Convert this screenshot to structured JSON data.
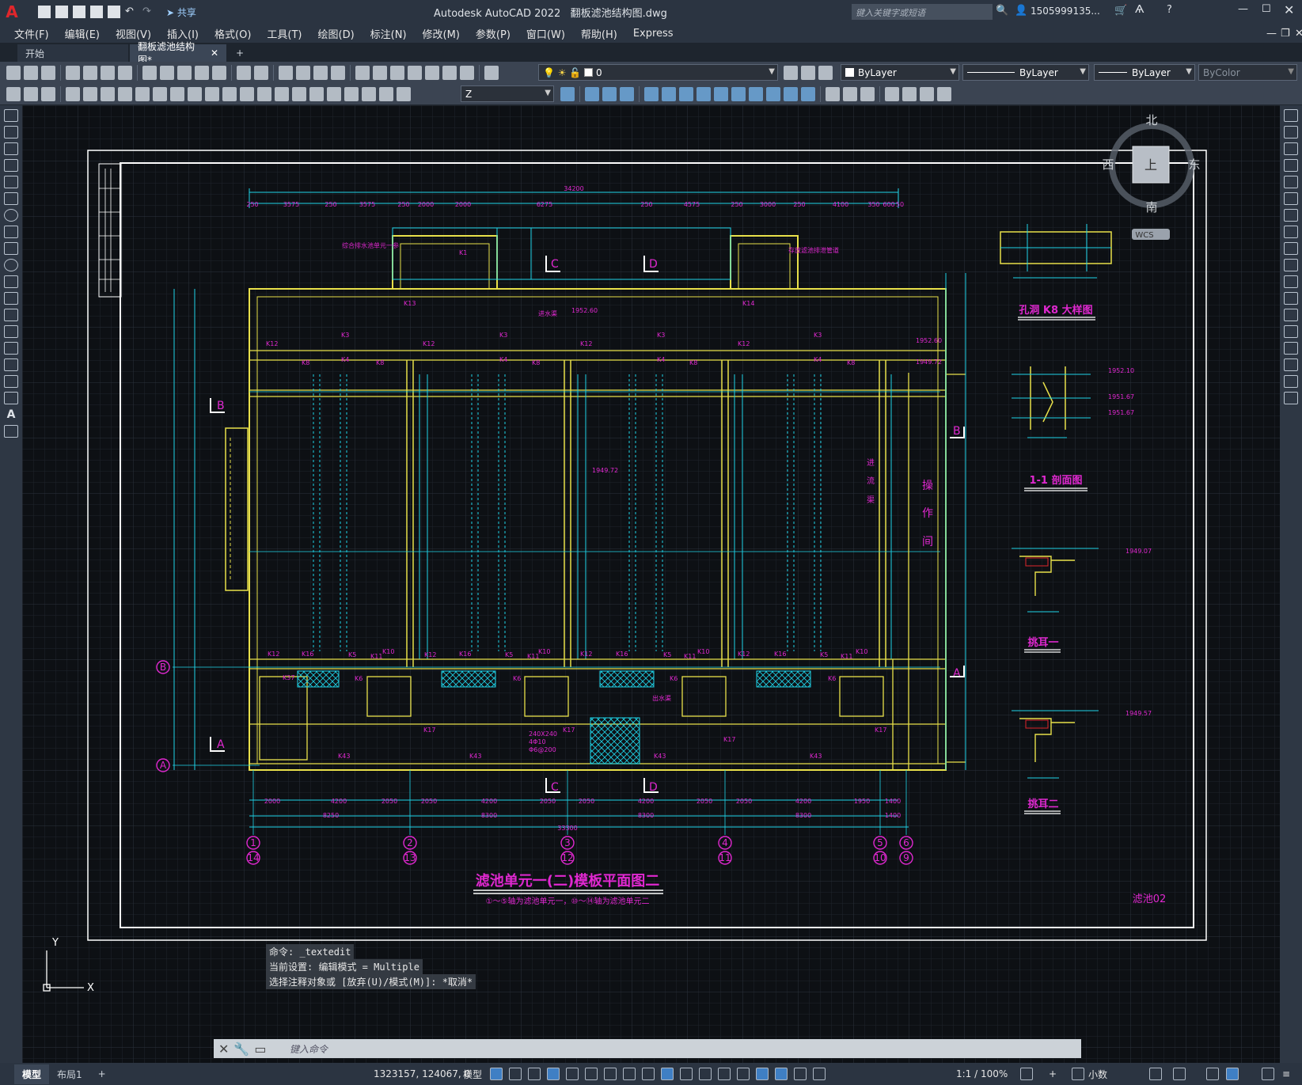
{
  "app": {
    "title": "Autodesk AutoCAD 2022",
    "filename": "翻板滤池结构图.dwg",
    "search_placeholder": "键入关键字或短语",
    "user": "1505999135...",
    "share_label": "共享"
  },
  "menu": [
    "文件(F)",
    "编辑(E)",
    "视图(V)",
    "插入(I)",
    "格式(O)",
    "工具(T)",
    "绘图(D)",
    "标注(N)",
    "修改(M)",
    "参数(P)",
    "窗口(W)",
    "帮助(H)",
    "Express"
  ],
  "tabs": [
    {
      "label": "开始"
    },
    {
      "label": "翻板滤池结构图*"
    }
  ],
  "layer_combo": "0",
  "properties": {
    "color": "ByLayer",
    "linetype": "ByLayer",
    "lineweight": "ByLayer",
    "plotstyle": "ByColor"
  },
  "ucs_combo": "Z",
  "viewcube": {
    "north": "北",
    "south": "南",
    "east": "东",
    "west": "西",
    "top": "上",
    "wcs": "WCS"
  },
  "drawing": {
    "title": "滤池单元一(二)模板平面图二",
    "subtitle": "①～⑤轴为滤池单元一，⑩～⑭轴为滤池单元二",
    "sheet_no": "滤池02",
    "detail_k8": "孔洞 K8 大样图",
    "section_11": "1-1 剖面图",
    "bracket_1": "挑耳一",
    "bracket_2": "挑耳二",
    "operation_room": [
      "操",
      "作",
      "间"
    ],
    "channel": [
      "进",
      "流",
      "渠"
    ],
    "total_dim": "34200",
    "bottom_total": "33300",
    "axis_labels_top": [
      "1",
      "2",
      "3",
      "4",
      "5",
      "6"
    ],
    "axis_labels_bottom": [
      "14",
      "13",
      "12",
      "11",
      "10",
      "9"
    ],
    "row_labels": [
      "B",
      "A"
    ],
    "section_marks": [
      "C",
      "D",
      "B",
      "A"
    ],
    "top_dims": [
      "250",
      "3575",
      "250",
      "3575",
      "250",
      "2000",
      "2000",
      "6275",
      "250",
      "4575",
      "250",
      "3000",
      "250",
      "4100",
      "350",
      "600",
      "50"
    ],
    "bottom_dims": [
      "2000",
      "4200",
      "2050",
      "2050",
      "4200",
      "2050",
      "2050",
      "4200",
      "2050",
      "2050",
      "4200",
      "1950",
      "1400"
    ],
    "sub_dims": [
      "8250",
      "8300",
      "8300",
      "8300",
      "8200",
      "1400"
    ],
    "kid_labels": [
      "K1",
      "K3",
      "K4",
      "K8",
      "K12",
      "K13",
      "K14",
      "K16",
      "K17",
      "K43",
      "K5",
      "K10",
      "K11",
      "K6",
      "K37"
    ],
    "elev_labels": [
      "1952.60",
      "1952.60",
      "1949.72",
      "1949.72",
      "1952.10",
      "1951.67",
      "1951.67",
      "1949.07",
      "1949.57"
    ],
    "annotations": [
      "综合排水池单元一参",
      "存放滤池排泄管道",
      "进水渠",
      "出水渠",
      "240X240",
      "4Φ10",
      "Φ6@200"
    ]
  },
  "command_history": [
    "命令: _textedit",
    "当前设置: 编辑模式 = Multiple",
    "选择注释对象或 [放弃(U)/模式(M)]: *取消*"
  ],
  "command_prompt": "键入命令",
  "status": {
    "layout_tabs": [
      "模型",
      "布局1"
    ],
    "coords": "1323157, 124067, 0",
    "space": "模型",
    "scale": "1:1 / 100%",
    "units": "小数"
  }
}
